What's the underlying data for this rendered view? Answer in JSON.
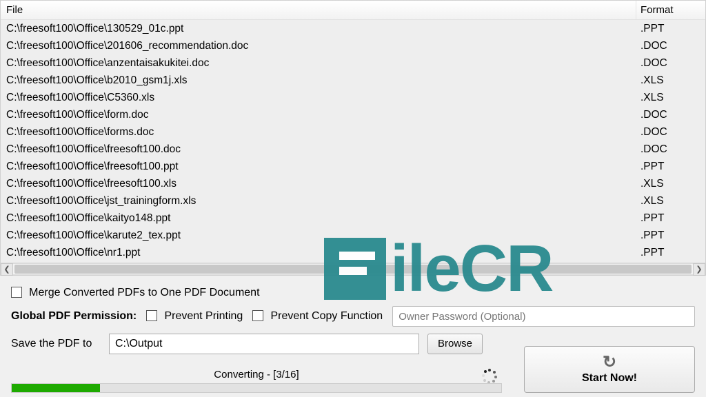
{
  "columns": {
    "file": "File",
    "format": "Format"
  },
  "files": [
    {
      "path": "C:\\freesoft100\\Office\\130529_01c.ppt",
      "format": ".PPT"
    },
    {
      "path": "C:\\freesoft100\\Office\\201606_recommendation.doc",
      "format": ".DOC"
    },
    {
      "path": "C:\\freesoft100\\Office\\anzentaisakukitei.doc",
      "format": ".DOC"
    },
    {
      "path": "C:\\freesoft100\\Office\\b2010_gsm1j.xls",
      "format": ".XLS"
    },
    {
      "path": "C:\\freesoft100\\Office\\C5360.xls",
      "format": ".XLS"
    },
    {
      "path": "C:\\freesoft100\\Office\\form.doc",
      "format": ".DOC"
    },
    {
      "path": "C:\\freesoft100\\Office\\forms.doc",
      "format": ".DOC"
    },
    {
      "path": "C:\\freesoft100\\Office\\freesoft100.doc",
      "format": ".DOC"
    },
    {
      "path": "C:\\freesoft100\\Office\\freesoft100.ppt",
      "format": ".PPT"
    },
    {
      "path": "C:\\freesoft100\\Office\\freesoft100.xls",
      "format": ".XLS"
    },
    {
      "path": "C:\\freesoft100\\Office\\jst_trainingform.xls",
      "format": ".XLS"
    },
    {
      "path": "C:\\freesoft100\\Office\\kaityo148.ppt",
      "format": ".PPT"
    },
    {
      "path": "C:\\freesoft100\\Office\\karute2_tex.ppt",
      "format": ".PPT"
    },
    {
      "path": "C:\\freesoft100\\Office\\nr1.ppt",
      "format": ".PPT"
    }
  ],
  "options": {
    "merge_label": "Merge Converted PDFs to One PDF Document",
    "global_perm_label": "Global PDF Permission:",
    "prevent_print_label": "Prevent Printing",
    "prevent_copy_label": "Prevent Copy Function",
    "owner_pw_placeholder": "Owner Password (Optional)"
  },
  "save": {
    "label": "Save the PDF to",
    "path": "C:\\Output",
    "browse": "Browse"
  },
  "status": {
    "text": "Converting - [3/16]",
    "progress_percent": 18
  },
  "start_button": "Start Now!",
  "watermark": "ileCR"
}
